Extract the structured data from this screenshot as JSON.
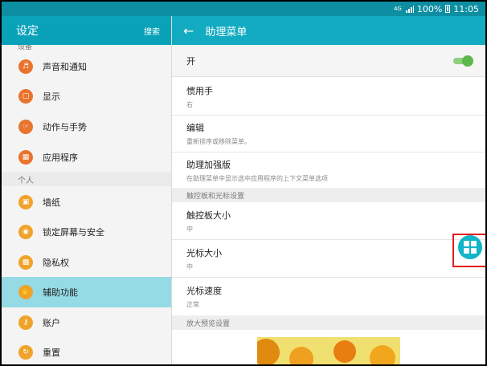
{
  "status_bar": {
    "network": "4G",
    "battery": "100%",
    "time": "11:05"
  },
  "left_header": {
    "title": "设定",
    "search": "搜索"
  },
  "right_header": {
    "title": "助理菜单",
    "back_icon": "arrow-left-icon"
  },
  "left_panel": {
    "cut_label": "设备",
    "items_top": [
      {
        "label": "声音和通知",
        "icon": "volume-icon",
        "color": "#e8742e"
      },
      {
        "label": "显示",
        "icon": "display-icon",
        "color": "#e8742e"
      },
      {
        "label": "动作与手势",
        "icon": "gesture-icon",
        "color": "#e8742e"
      },
      {
        "label": "应用程序",
        "icon": "apps-icon",
        "color": "#e8742e"
      }
    ],
    "section_personal": "个人",
    "items_personal": [
      {
        "label": "墙纸",
        "icon": "wallpaper-icon",
        "color": "#f0a32a"
      },
      {
        "label": "锁定屏幕与安全",
        "icon": "lock-icon",
        "color": "#f0a32a"
      },
      {
        "label": "隐私权",
        "icon": "privacy-icon",
        "color": "#f0a32a"
      },
      {
        "label": "辅助功能",
        "icon": "hand-icon",
        "color": "#f0a32a",
        "selected": true
      },
      {
        "label": "账户",
        "icon": "key-icon",
        "color": "#f0a32a"
      },
      {
        "label": "重置",
        "icon": "reset-icon",
        "color": "#f0a32a"
      }
    ]
  },
  "right_panel": {
    "toggle": {
      "label": "开",
      "on": true
    },
    "dominant_hand": {
      "title": "惯用手",
      "value": "右"
    },
    "edit": {
      "title": "编辑",
      "desc": "重新排序或移除菜单。"
    },
    "plus": {
      "title": "助理加强版",
      "desc": "在助理菜单中显示选中应用程序的上下文菜单选项"
    },
    "section_touchpad": "触控板和光标设置",
    "touchpad_size": {
      "title": "触控板大小",
      "value": "中"
    },
    "cursor_size": {
      "title": "光标大小",
      "value": "中"
    },
    "cursor_speed": {
      "title": "光标速度",
      "value": "正常"
    },
    "section_zoom": "放大预览设置"
  },
  "colors": {
    "accent": "#0aa2b8",
    "selected": "#95dbe6",
    "highlight_box": "#e31b1b",
    "switch_on": "#5cb84a"
  }
}
